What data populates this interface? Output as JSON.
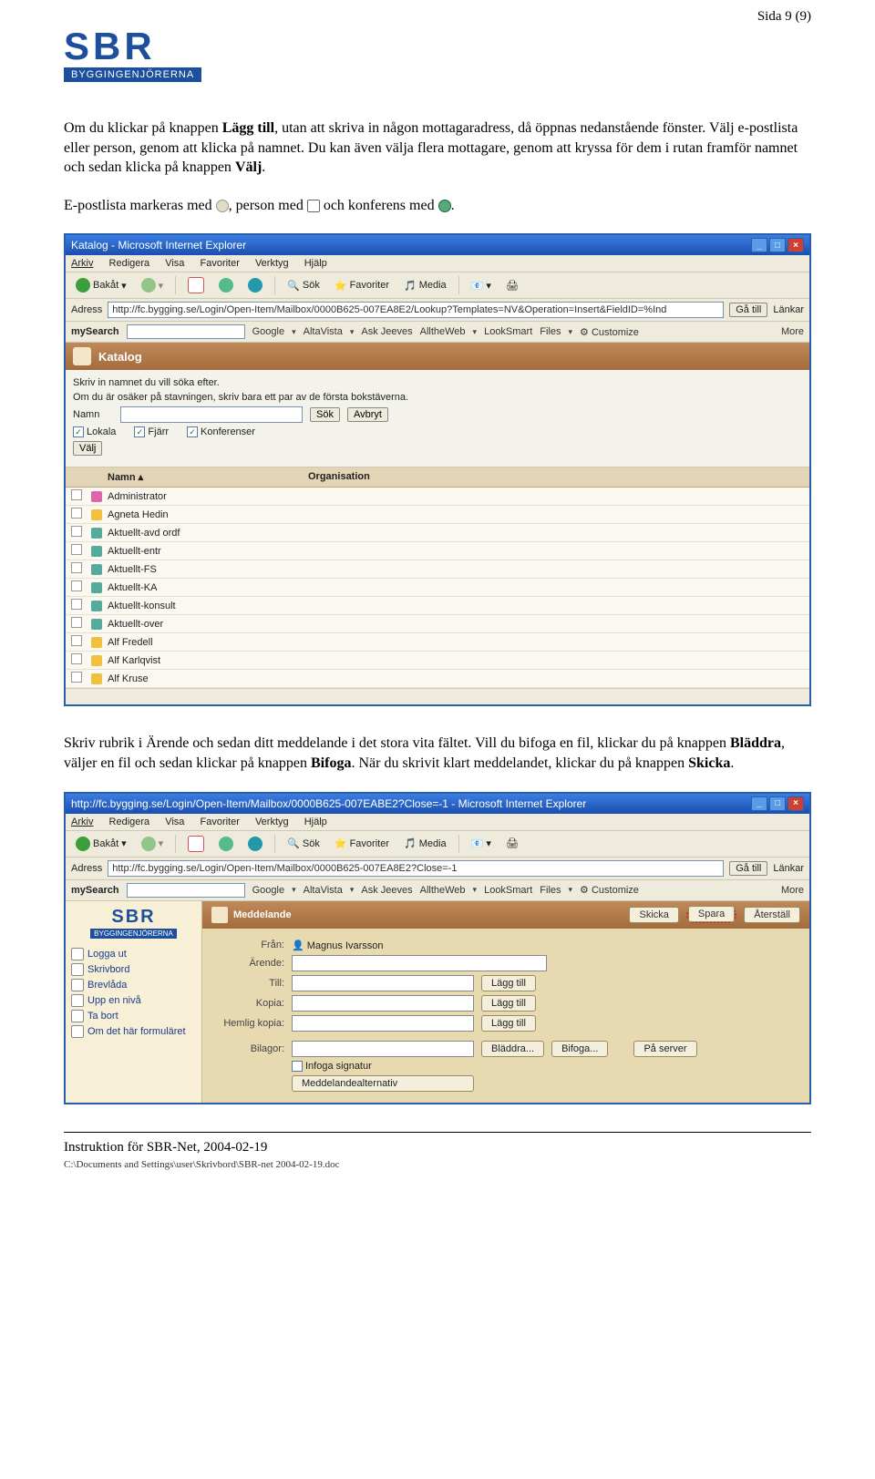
{
  "page_number": "Sida 9 (9)",
  "logo": {
    "main": "SBR",
    "sub": "BYGGINGENJÖRERNA"
  },
  "para1_parts": [
    "Om du klickar på knappen ",
    "Lägg till",
    ", utan att skriva in någon mottagaradress, då öppnas nedanstående fönster. Välj e-postlista eller person, genom att klicka på namnet. Du kan även välja flera mottagare, genom att kryssa för dem i rutan framför namnet och sedan klicka på knappen ",
    "Välj",
    "."
  ],
  "para2_parts": [
    "E-postlista markeras med ",
    ", person med ",
    " och konferens med ",
    "."
  ],
  "para3_parts": [
    "Skriv rubrik i Ärende och sedan ditt meddelande i det stora vita fältet. Vill du bifoga en fil, klickar du på knappen ",
    "Bläddra",
    ", väljer en fil och sedan klickar på knappen ",
    "Bifoga",
    ". När du skrivit klart meddelandet, klickar du på knappen ",
    "Skicka",
    "."
  ],
  "win1": {
    "title": "Katalog - Microsoft Internet Explorer",
    "menus": [
      "Arkiv",
      "Redigera",
      "Visa",
      "Favoriter",
      "Verktyg",
      "Hjälp"
    ],
    "toolbar": {
      "back": "Bakåt",
      "search": "Sök",
      "fav": "Favoriter",
      "media": "Media"
    },
    "address_label": "Adress",
    "address": "http://fc.bygging.se/Login/Open-Item/Mailbox/0000B625-007EA8E2/Lookup?Templates=NV&Operation=Insert&FieldID=%Ind",
    "go": "Gå till",
    "links": "Länkar",
    "search_row": {
      "brand": "mySearch",
      "engines": [
        "Google",
        "AltaVista",
        "Ask Jeeves",
        "AlltheWeb",
        "LookSmart",
        "Files"
      ],
      "custom": "Customize",
      "more": "More"
    },
    "katalog": {
      "title": "Katalog",
      "instr1": "Skriv in namnet du vill söka efter.",
      "instr2": "Om du är osäker på stavningen, skriv bara ett par av de första bokstäverna.",
      "name_label": "Namn",
      "sok": "Sök",
      "avbryt": "Avbryt",
      "checks": [
        "Lokala",
        "Fjärr",
        "Konferenser"
      ],
      "valj": "Välj",
      "cols": {
        "name": "Namn",
        "org": "Organisation"
      },
      "rows": [
        {
          "icon": "adm",
          "name": "Administrator"
        },
        {
          "icon": "per",
          "name": "Agneta Hedin"
        },
        {
          "icon": "conf",
          "name": "Aktuellt-avd ordf"
        },
        {
          "icon": "conf",
          "name": "Aktuellt-entr"
        },
        {
          "icon": "conf",
          "name": "Aktuellt-FS"
        },
        {
          "icon": "conf",
          "name": "Aktuellt-KA"
        },
        {
          "icon": "conf",
          "name": "Aktuellt-konsult"
        },
        {
          "icon": "conf",
          "name": "Aktuellt-over"
        },
        {
          "icon": "per",
          "name": "Alf Fredell"
        },
        {
          "icon": "per",
          "name": "Alf Karlqvist"
        },
        {
          "icon": "per",
          "name": "Alf Kruse"
        }
      ]
    }
  },
  "win2": {
    "title": "http://fc.bygging.se/Login/Open-Item/Mailbox/0000B625-007EABE2?Close=-1 - Microsoft Internet Explorer",
    "menus": [
      "Arkiv",
      "Redigera",
      "Visa",
      "Favoriter",
      "Verktyg",
      "Hjälp"
    ],
    "toolbar": {
      "back": "Bakåt",
      "search": "Sök",
      "fav": "Favoriter",
      "media": "Media"
    },
    "address_label": "Adress",
    "address": "http://fc.bygging.se/Login/Open-Item/Mailbox/0000B625-007EA8E2?Close=-1",
    "go": "Gå till",
    "links": "Länkar",
    "search_row": {
      "brand": "mySearch",
      "engines": [
        "Google",
        "AltaVista",
        "Ask Jeeves",
        "AlltheWeb",
        "LookSmart",
        "Files"
      ],
      "custom": "Customize",
      "more": "More"
    },
    "sidebar": [
      "Logga ut",
      "Skrivbord",
      "Brevlåda",
      "Upp en nivå",
      "Ta bort",
      "Om det här formuläret"
    ],
    "compose": {
      "header": "Meddelande",
      "buttons": {
        "send": "Skicka",
        "save": "Spara",
        "reset": "Återställ"
      },
      "from_label": "Från:",
      "from": "Magnus Ivarsson",
      "subject_label": "Ärende:",
      "to_label": "Till:",
      "cc_label": "Kopia:",
      "bcc_label": "Hemlig kopia:",
      "add": "Lägg till",
      "attach_label": "Bilagor:",
      "browse": "Bläddra...",
      "attach": "Bifoga...",
      "server": "På server",
      "sig": "Infoga signatur",
      "alt": "Meddelandealternativ"
    }
  },
  "footer": {
    "line": "Instruktion för SBR-Net, 2004-02-19",
    "path": "C:\\Documents and Settings\\user\\Skrivbord\\SBR-net 2004-02-19.doc"
  }
}
